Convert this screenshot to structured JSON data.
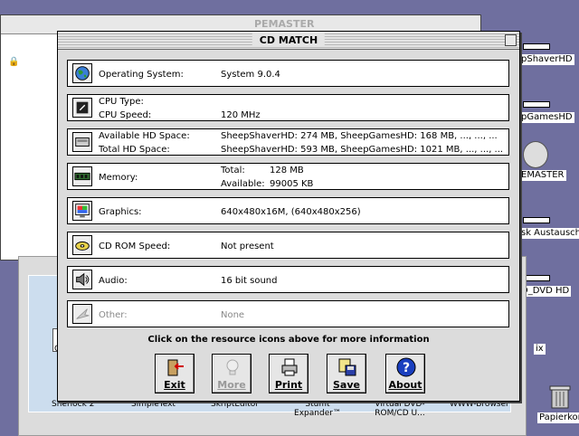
{
  "background_window": {
    "title": "PEMASTER"
  },
  "desktop_labels": [
    "pShaverHD",
    "pGamesHD",
    "EMASTER",
    "sk Austausch",
    "D_DVD HD",
    "ix",
    "Papierkorb"
  ],
  "background_apps": [
    "Sherlock 2",
    "SimpleText",
    "SkriptEditor",
    "Stuffit Expander™",
    "Virtual DVD-ROM/CD U...",
    "WWW-Browser"
  ],
  "bg_partial_letter": "C",
  "dialog": {
    "title": "CD MATCH",
    "rows": [
      {
        "label": "Operating System:",
        "value": "System 9.0.4"
      },
      {
        "label": "CPU Type:",
        "value": ""
      },
      {
        "label": "CPU Speed:",
        "value": "120 MHz"
      },
      {
        "label": "Available HD Space:",
        "value": "SheepShaverHD: 274 MB, SheepGamesHD: 168 MB, ..., ..., ..."
      },
      {
        "label": "Total HD Space:",
        "value": "SheepShaverHD: 593 MB, SheepGamesHD: 1021 MB, ..., ..., ..."
      },
      {
        "label": "Memory:",
        "value": ""
      },
      {
        "label": "Total:",
        "value": "128 MB"
      },
      {
        "label": "Available:",
        "value": "99005 KB"
      },
      {
        "label": "Graphics:",
        "value": "640x480x16M, (640x480x256)"
      },
      {
        "label": "CD ROM Speed:",
        "value": "Not present"
      },
      {
        "label": "Audio:",
        "value": "16 bit sound"
      },
      {
        "label": "Other:",
        "value": "None"
      }
    ],
    "hint": "Click on the resource icons above for more information",
    "buttons": {
      "exit": "Exit",
      "more": "More",
      "print": "Print",
      "save": "Save",
      "about": "About"
    }
  },
  "icons": {
    "os": "globe-icon",
    "cpu": "chip-icon",
    "hd": "harddisk-icon",
    "memory": "memory-icon",
    "graphics": "monitor-icon",
    "cdrom": "cd-icon",
    "audio": "speaker-icon",
    "other": "other-icon"
  },
  "colors": {
    "desktop": "#6f6f9f",
    "dialog": "#dcdcdc",
    "help": "#1a3fbf",
    "exit_arrow": "#d00000"
  }
}
